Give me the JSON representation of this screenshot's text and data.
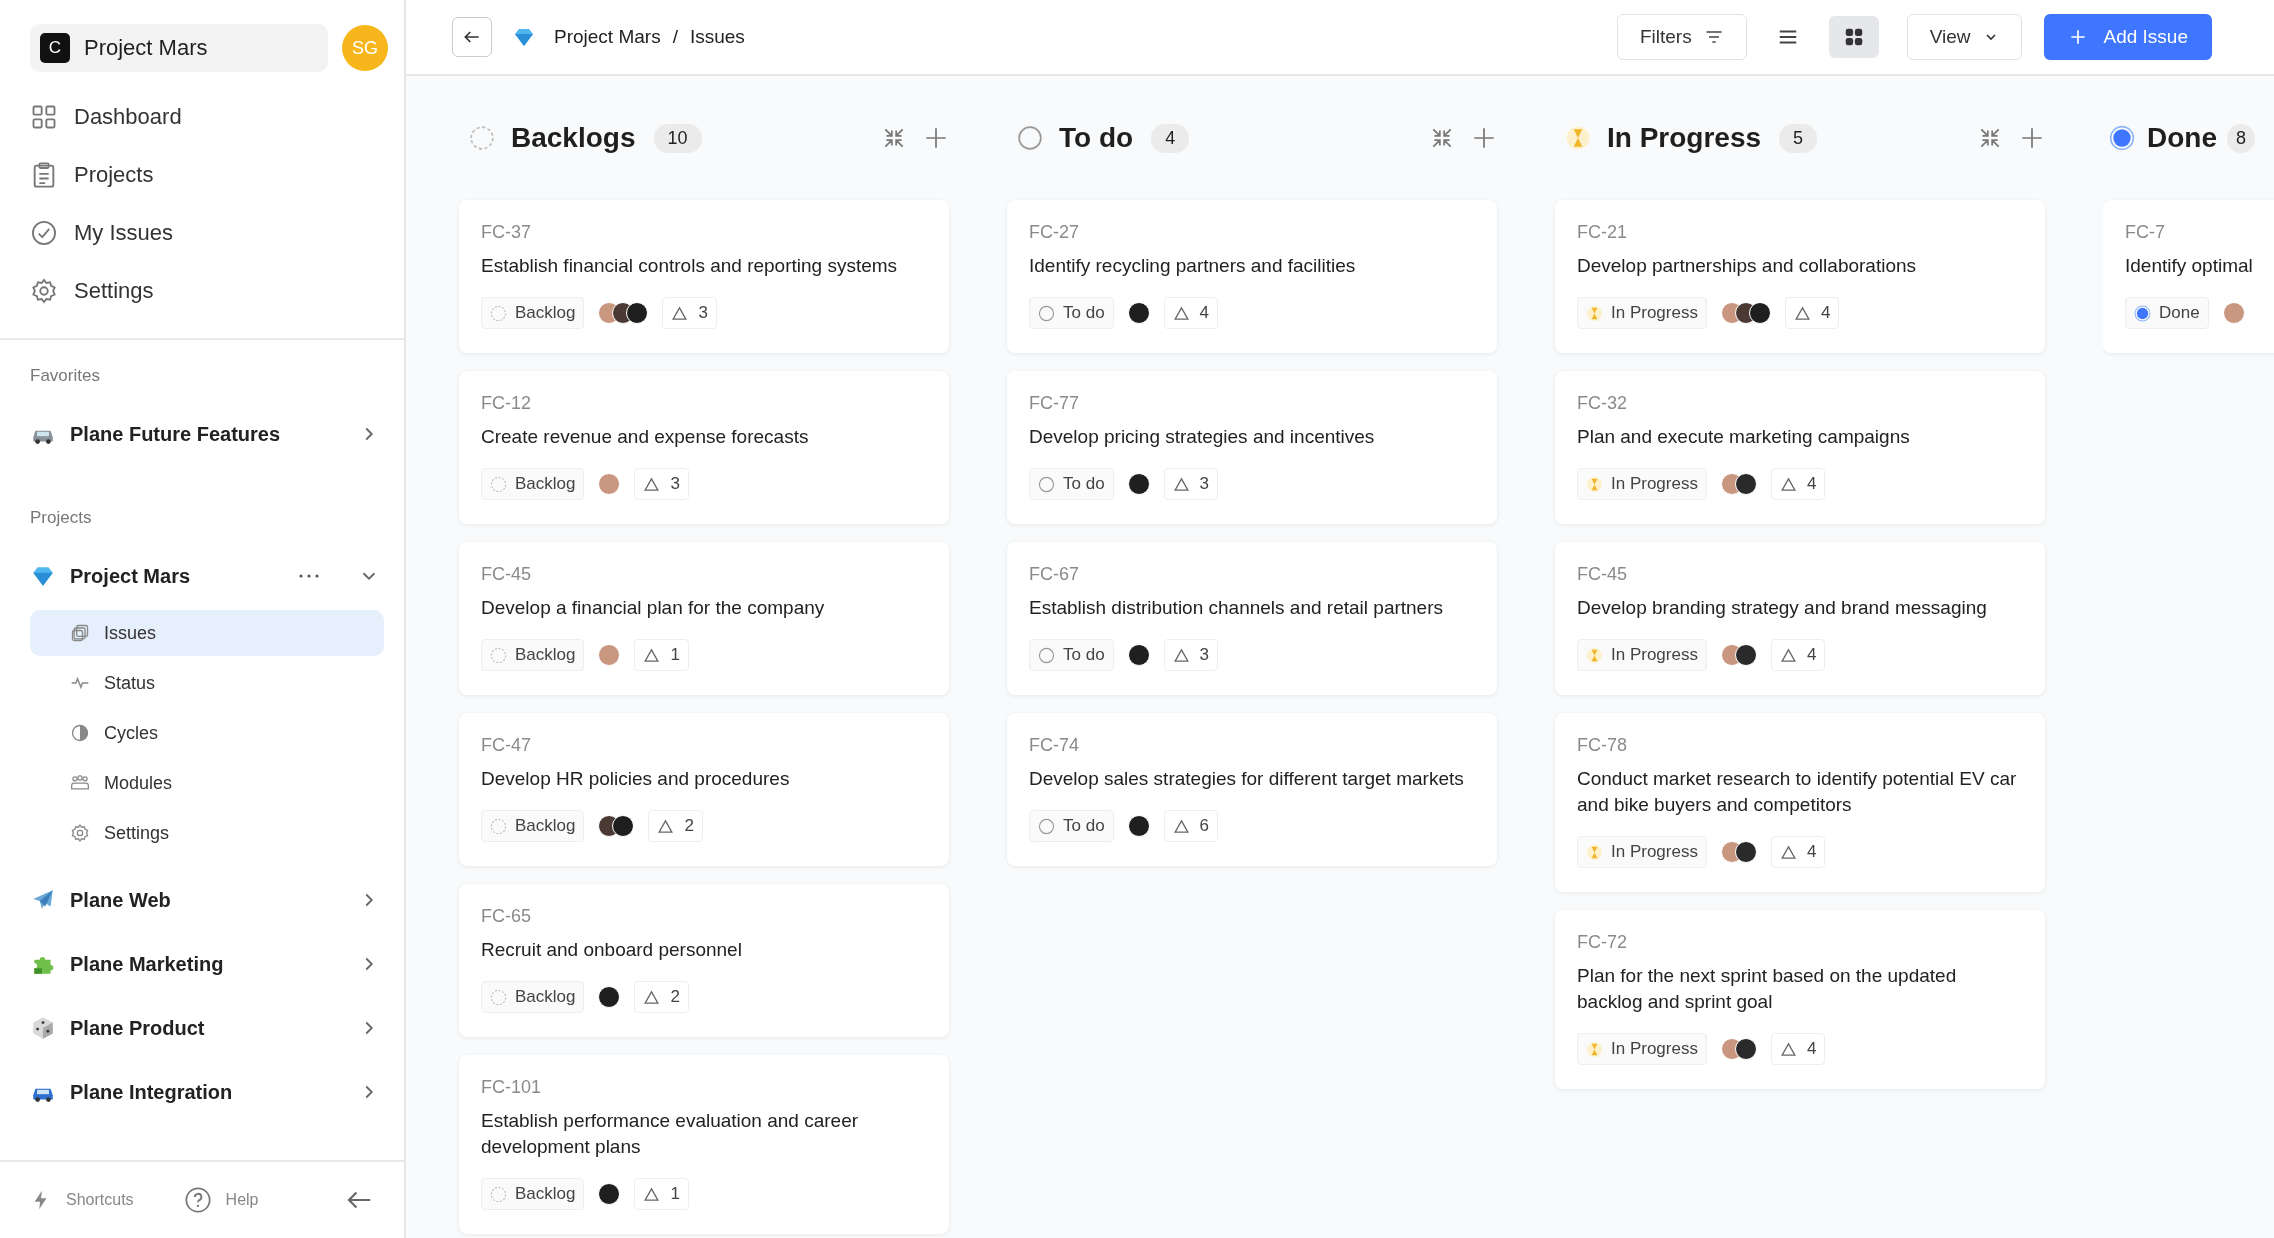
{
  "workspace": {
    "initial": "C",
    "name": "Project Mars",
    "avatar": "SG"
  },
  "nav": [
    {
      "label": "Dashboard",
      "kind": "dashboard",
      "selected": false
    },
    {
      "label": "Projects",
      "kind": "projects",
      "selected": false
    },
    {
      "label": "My Issues",
      "kind": "issues",
      "selected": false
    },
    {
      "label": "Settings",
      "kind": "settings",
      "selected": false
    }
  ],
  "favorites": {
    "heading": "Favorites",
    "items": [
      {
        "label": "Plane Future Features",
        "kind": "car",
        "expanded": false
      }
    ]
  },
  "projects": {
    "heading": "Projects",
    "items": [
      {
        "label": "Project Mars",
        "kind": "gem",
        "expanded": true,
        "children": [
          {
            "label": "Issues",
            "kind": "issues",
            "selected": true
          },
          {
            "label": "Status",
            "kind": "status",
            "selected": false
          },
          {
            "label": "Cycles",
            "kind": "cycles",
            "selected": false
          },
          {
            "label": "Modules",
            "kind": "modules",
            "selected": false
          },
          {
            "label": "Settings",
            "kind": "settings",
            "selected": false
          }
        ]
      },
      {
        "label": "Plane Web",
        "kind": "plane",
        "expanded": false
      },
      {
        "label": "Plane Marketing",
        "kind": "puzzle",
        "expanded": false
      },
      {
        "label": "Plane Product",
        "kind": "dice",
        "expanded": false
      },
      {
        "label": "Plane Integration",
        "kind": "car",
        "expanded": false
      }
    ]
  },
  "footer": {
    "shortcuts": "Shortcuts",
    "help": "Help"
  },
  "topbar": {
    "breadcrumb": [
      "Project Mars",
      "Issues"
    ],
    "separator": "/",
    "filters": "Filters",
    "layouts": [
      {
        "kind": "list",
        "selected": false
      },
      {
        "kind": "board",
        "selected": true
      }
    ],
    "view": "View",
    "add": "Add Issue"
  },
  "columns": [
    {
      "title": "Backlogs",
      "count": "10",
      "kind": "backlog",
      "actions": true,
      "cards": [
        {
          "id": "FC-37",
          "title": "Establish financial controls and reporting systems",
          "state": "Backlog",
          "assignees": [
            {
              "color": "#c9977f"
            },
            {
              "color": "#4a3a33"
            },
            {
              "color": "#1f1f1f"
            }
          ],
          "estimate": "3"
        },
        {
          "id": "FC-12",
          "title": "Create revenue and expense forecasts",
          "state": "Backlog",
          "assignees": [
            {
              "color": "#c9977f"
            }
          ],
          "estimate": "3"
        },
        {
          "id": "FC-45",
          "title": "Develop a financial plan for the company",
          "state": "Backlog",
          "assignees": [
            {
              "color": "#c9977f"
            }
          ],
          "estimate": "1"
        },
        {
          "id": "FC-47",
          "title": "Develop HR policies and procedures",
          "state": "Backlog",
          "assignees": [
            {
              "color": "#4a3a33"
            },
            {
              "color": "#1f1f1f"
            }
          ],
          "estimate": "2"
        },
        {
          "id": "FC-65",
          "title": "Recruit and onboard personnel",
          "state": "Backlog",
          "assignees": [
            {
              "color": "#1f1f1f"
            }
          ],
          "estimate": "2"
        },
        {
          "id": "FC-101",
          "title": "Establish performance evaluation and career development plans",
          "state": "Backlog",
          "assignees": [
            {
              "color": "#1f1f1f"
            }
          ],
          "estimate": "1"
        }
      ]
    },
    {
      "title": "To do",
      "count": "4",
      "kind": "todo",
      "actions": true,
      "cards": [
        {
          "id": "FC-27",
          "title": "Identify recycling partners and facilities",
          "state": "To do",
          "assignees": [
            {
              "color": "#1f1f1f"
            }
          ],
          "estimate": "4"
        },
        {
          "id": "FC-77",
          "title": "Develop pricing strategies and incentives",
          "state": "To do",
          "assignees": [
            {
              "color": "#1f1f1f"
            }
          ],
          "estimate": "3"
        },
        {
          "id": "FC-67",
          "title": "Establish distribution channels and retail partners",
          "state": "To do",
          "assignees": [
            {
              "color": "#1f1f1f"
            }
          ],
          "estimate": "3"
        },
        {
          "id": "FC-74",
          "title": "Develop sales strategies for different target markets",
          "state": "To do",
          "assignees": [
            {
              "color": "#1f1f1f"
            }
          ],
          "estimate": "6"
        }
      ]
    },
    {
      "title": "In Progress",
      "count": "5",
      "kind": "progress",
      "actions": true,
      "cards": [
        {
          "id": "FC-21",
          "title": "Develop partnerships and collaborations",
          "state": "In Progress",
          "assignees": [
            {
              "color": "#c9977f"
            },
            {
              "color": "#4a3a33"
            },
            {
              "color": "#1f1f1f"
            }
          ],
          "estimate": "4"
        },
        {
          "id": "FC-32",
          "title": "Plan and execute marketing campaigns",
          "state": "In Progress",
          "assignees": [
            {
              "color": "#c9977f"
            },
            {
              "color": "#2a2a2a"
            }
          ],
          "estimate": "4"
        },
        {
          "id": "FC-45",
          "title": "Develop branding strategy and brand messaging",
          "state": "In Progress",
          "assignees": [
            {
              "color": "#c9977f"
            },
            {
              "color": "#2a2a2a"
            }
          ],
          "estimate": "4"
        },
        {
          "id": "FC-78",
          "title": "Conduct market research to identify potential EV car and bike buyers and competitors",
          "state": "In Progress",
          "assignees": [
            {
              "color": "#c9977f"
            },
            {
              "color": "#2a2a2a"
            }
          ],
          "estimate": "4"
        },
        {
          "id": "FC-72",
          "title": "Plan for the next sprint based on the updated backlog and sprint goal",
          "state": "In Progress",
          "assignees": [
            {
              "color": "#c9977f"
            },
            {
              "color": "#2a2a2a"
            }
          ],
          "estimate": "4"
        }
      ]
    },
    {
      "title": "Done",
      "count": "8",
      "kind": "done",
      "actions": false,
      "cards": [
        {
          "id": "FC-7",
          "title": "Identify optimal",
          "state": "Done",
          "assignees": [
            {
              "color": "#c9977f"
            }
          ]
        }
      ]
    }
  ]
}
